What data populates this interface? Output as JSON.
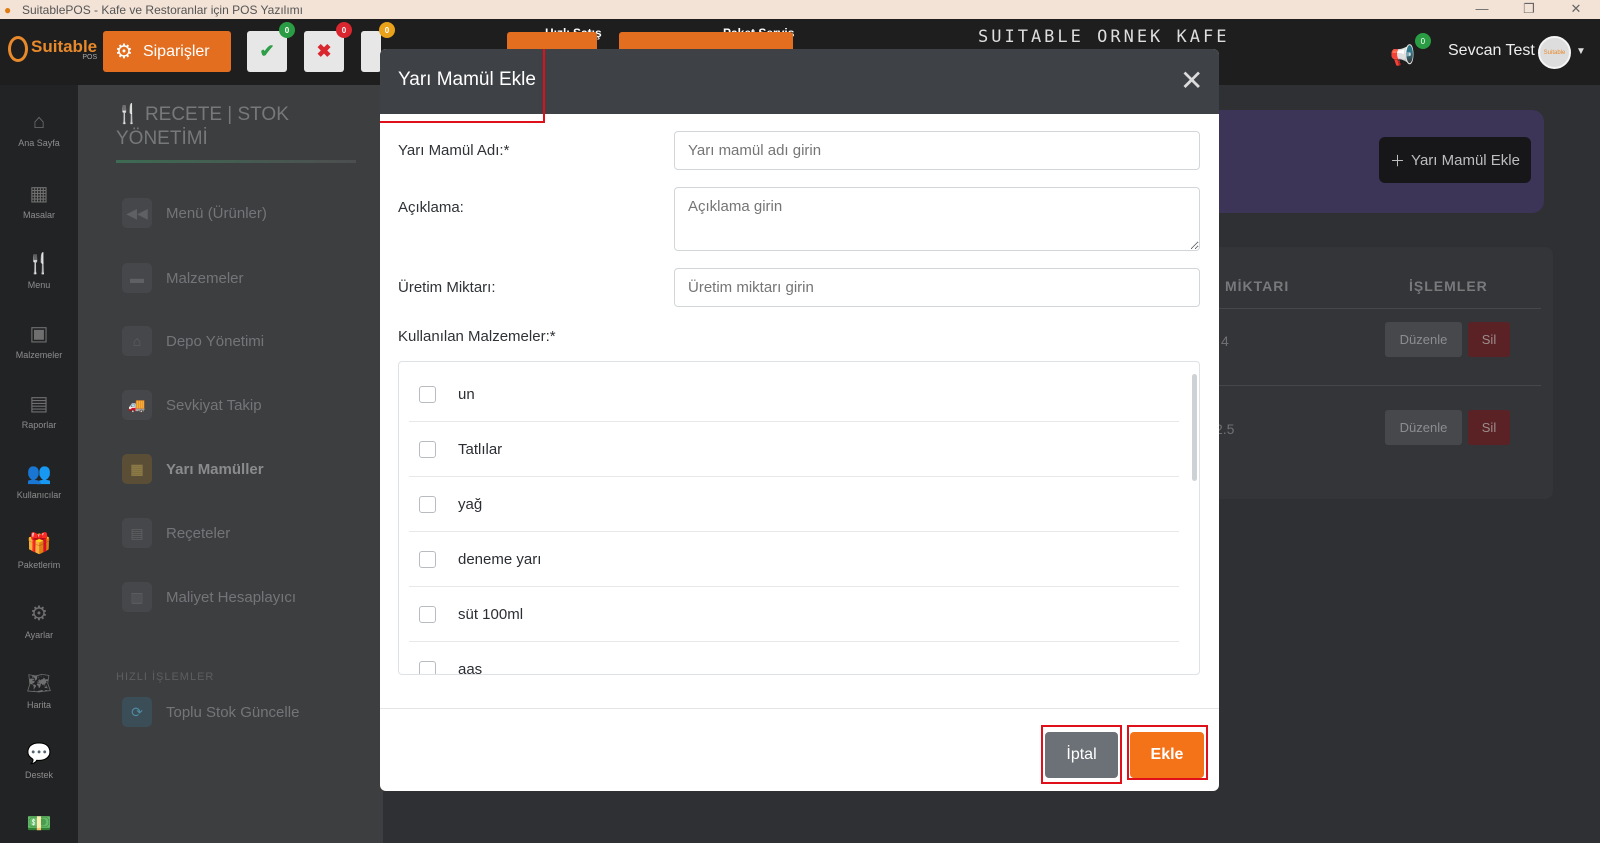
{
  "window": {
    "title": "SuitablePOS - Kafe ve Restoranlar için POS Yazılımı",
    "controls": [
      "—",
      "❐",
      "✕"
    ]
  },
  "topbar": {
    "logo_text": "Suitable",
    "logo_sub": "POS",
    "orders_label": "Siparişler",
    "approve_badge": "0",
    "reject_badge": "0",
    "third_badge": "0",
    "quick_sale_label": "Hızlı Satış",
    "package_label": "Paket Servis",
    "cafe_name": "SUITABLE ORNEK KAFE",
    "notification_badge": "0",
    "user_name": "Sevcan Test",
    "avatar_text": "Suitable"
  },
  "sidebar": {
    "items": [
      {
        "label": "Ana Sayfa",
        "icon": "home-icon"
      },
      {
        "label": "Masalar",
        "icon": "table-icon"
      },
      {
        "label": "Menu",
        "icon": "utensils-icon"
      },
      {
        "label": "Malzemeler",
        "icon": "clipboard-icon"
      },
      {
        "label": "Raporlar",
        "icon": "report-icon"
      },
      {
        "label": "Kullanıcılar",
        "icon": "users-icon"
      },
      {
        "label": "Paketlerim",
        "icon": "gift-icon"
      },
      {
        "label": "Ayarlar",
        "icon": "settings-icon"
      },
      {
        "label": "Harita",
        "icon": "map-icon"
      },
      {
        "label": "Destek",
        "icon": "chat-icon"
      }
    ]
  },
  "subnav": {
    "heading_line1": "RECETE | STOK",
    "heading_line2": "YÖNETİMİ",
    "items": [
      {
        "label": "Menü (Ürünler)",
        "icon": "backward-icon"
      },
      {
        "label": "Malzemeler",
        "icon": "box-icon"
      },
      {
        "label": "Depo Yönetimi",
        "icon": "warehouse-icon"
      },
      {
        "label": "Sevkiyat Takip",
        "icon": "truck-icon"
      },
      {
        "label": "Yarı Mamüller",
        "icon": "boxes-icon"
      },
      {
        "label": "Reçeteler",
        "icon": "receipt-icon"
      },
      {
        "label": "Maliyet Hesaplayıcı",
        "icon": "calculator-icon"
      }
    ],
    "quick_title": "HIZLI İŞLEMLER",
    "quick_item": "Toplu Stok Güncelle"
  },
  "main": {
    "add_button": "Yarı Mamül Ekle",
    "col_amount": "MİKTARI",
    "col_actions": "İŞLEMLER",
    "rows": [
      {
        "amount": "4",
        "edit": "Düzenle",
        "delete": "Sil"
      },
      {
        "amount": "2.5",
        "edit": "Düzenle",
        "delete": "Sil"
      }
    ]
  },
  "modal": {
    "title": "Yarı Mamül Ekle",
    "name_label": "Yarı Mamül Adı:*",
    "name_placeholder": "Yarı mamül adı girin",
    "desc_label": "Açıklama:",
    "desc_placeholder": "Açıklama girin",
    "qty_label": "Üretim Miktarı:",
    "qty_placeholder": "Üretim miktarı girin",
    "materials_label": "Kullanılan Malzemeler:*",
    "materials": [
      "un",
      "Tatlılar",
      "yağ",
      "deneme yarı",
      "süt 100ml",
      "aas"
    ],
    "cancel_label": "İptal",
    "submit_label": "Ekle"
  },
  "colors": {
    "accent_orange": "#f47218",
    "modal_header": "#3e4146",
    "highlight_red": "#e0101a",
    "cancel_gray": "#6c7178"
  }
}
